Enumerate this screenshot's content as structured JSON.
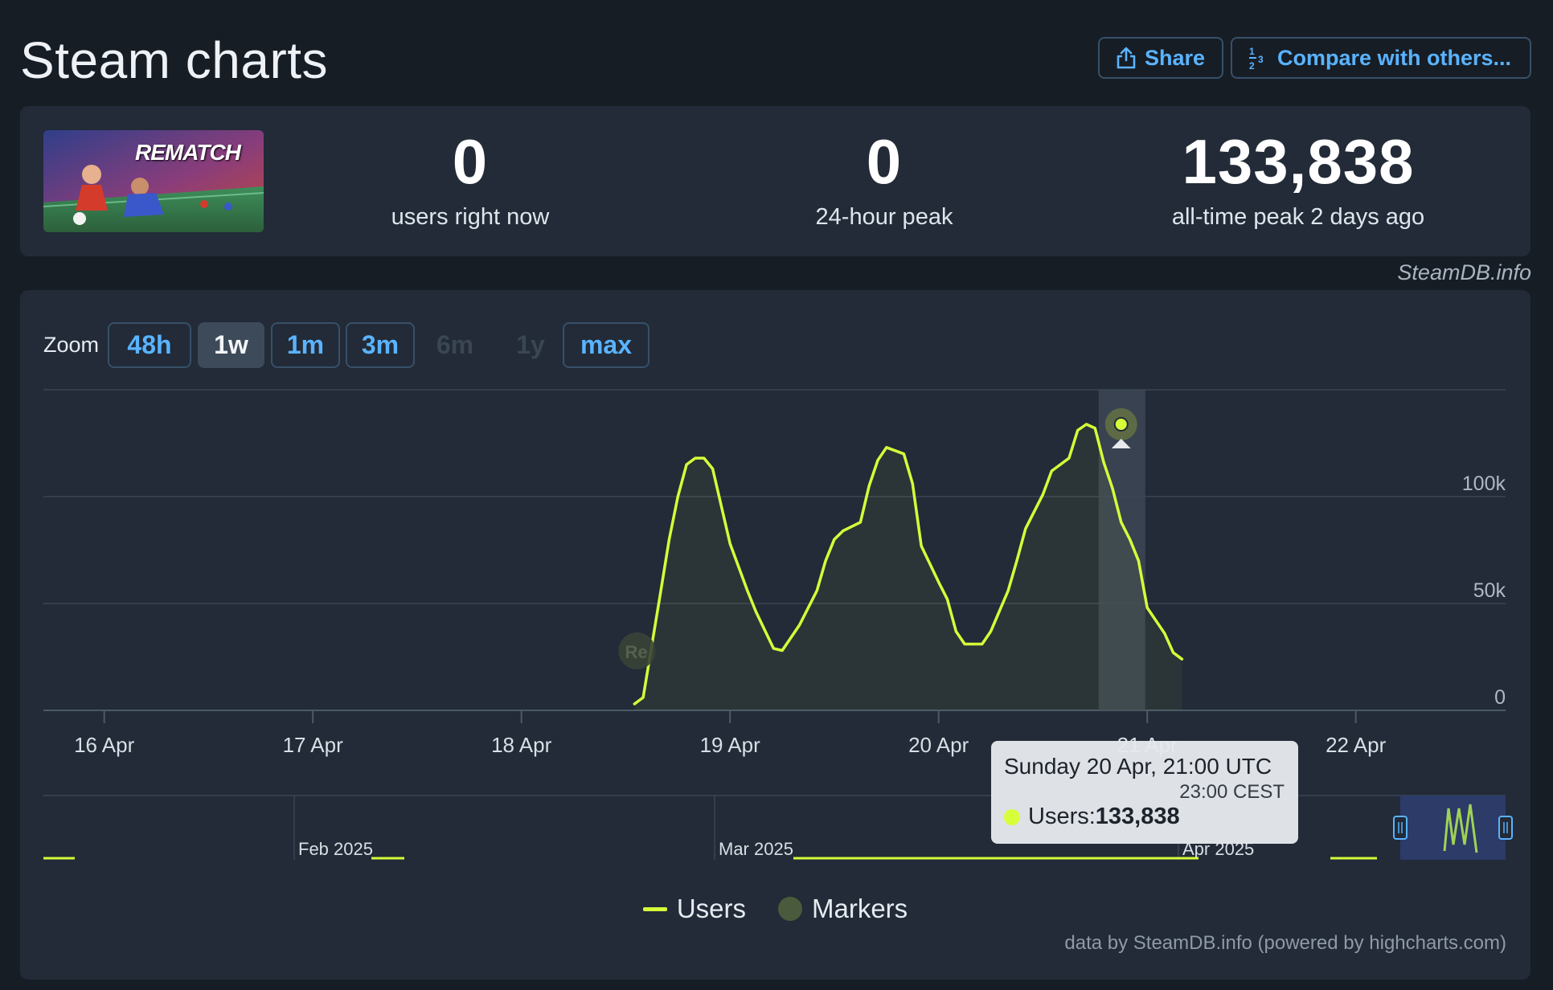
{
  "header": {
    "title": "Steam charts",
    "share_label": "Share",
    "compare_label": "Compare with others..."
  },
  "game": {
    "logo_text": "REMATCH"
  },
  "stats": [
    {
      "value": "0",
      "label": "users right now"
    },
    {
      "value": "0",
      "label": "24-hour peak"
    },
    {
      "value": "133,838",
      "label": "all-time peak 2 days ago"
    }
  ],
  "credit_top": "SteamDB.info",
  "zoom": {
    "label": "Zoom",
    "options": [
      {
        "label": "48h",
        "state": "enabled"
      },
      {
        "label": "1w",
        "state": "active"
      },
      {
        "label": "1m",
        "state": "enabled"
      },
      {
        "label": "3m",
        "state": "enabled"
      },
      {
        "label": "6m",
        "state": "disabled"
      },
      {
        "label": "1y",
        "state": "disabled"
      },
      {
        "label": "max",
        "state": "enabled"
      }
    ]
  },
  "tooltip": {
    "title": "Sunday 20 Apr, 21:00 UTC",
    "subtitle": "23:00 CEST",
    "series_label": "Users: ",
    "value": "133,838"
  },
  "marker_label": "Re",
  "legend": {
    "users": "Users",
    "markers": "Markers"
  },
  "footer_credit": "data by SteamDB.info (powered by highcharts.com)",
  "colors": {
    "line": "#d6ff3a",
    "accent": "#5ab3ff",
    "background": "#171d25",
    "card": "#222b37"
  },
  "chart_data": {
    "type": "line",
    "x_tick_labels": [
      "16 Apr",
      "17 Apr",
      "18 Apr",
      "19 Apr",
      "20 Apr",
      "21 Apr",
      "22 Apr"
    ],
    "y_tick_labels": [
      "0",
      "50k",
      "100k"
    ],
    "ylim": [
      0,
      150000
    ],
    "grid": true,
    "legend_position": "bottom",
    "series": [
      {
        "name": "Users",
        "x": [
          "2025-04-18T13:00",
          "2025-04-18T14:00",
          "2025-04-18T16:00",
          "2025-04-18T17:00",
          "2025-04-18T18:00",
          "2025-04-18T19:00",
          "2025-04-18T20:00",
          "2025-04-18T21:00",
          "2025-04-18T22:00",
          "2025-04-19T00:00",
          "2025-04-19T02:00",
          "2025-04-19T03:00",
          "2025-04-19T05:00",
          "2025-04-19T06:00",
          "2025-04-19T08:00",
          "2025-04-19T09:00",
          "2025-04-19T10:00",
          "2025-04-19T11:00",
          "2025-04-19T12:00",
          "2025-04-19T13:00",
          "2025-04-19T15:00",
          "2025-04-19T16:00",
          "2025-04-19T17:00",
          "2025-04-19T18:00",
          "2025-04-19T20:00",
          "2025-04-19T21:00",
          "2025-04-19T22:00",
          "2025-04-20T00:00",
          "2025-04-20T01:00",
          "2025-04-20T02:00",
          "2025-04-20T03:00",
          "2025-04-20T05:00",
          "2025-04-20T06:00",
          "2025-04-20T08:00",
          "2025-04-20T09:00",
          "2025-04-20T10:00",
          "2025-04-20T12:00",
          "2025-04-20T13:00",
          "2025-04-20T15:00",
          "2025-04-20T16:00",
          "2025-04-20T17:00",
          "2025-04-20T18:00",
          "2025-04-20T19:00",
          "2025-04-20T20:00",
          "2025-04-20T21:00",
          "2025-04-20T22:00",
          "2025-04-20T23:00",
          "2025-04-21T00:00",
          "2025-04-21T02:00",
          "2025-04-21T03:00",
          "2025-04-21T04:00"
        ],
        "values": [
          3000,
          6000,
          55000,
          80000,
          100000,
          115000,
          118000,
          118000,
          113000,
          78000,
          56000,
          46000,
          29000,
          28000,
          40000,
          48000,
          56000,
          70000,
          80000,
          84000,
          88000,
          105000,
          117000,
          123000,
          120000,
          106000,
          77000,
          60000,
          52000,
          37000,
          31000,
          31000,
          37000,
          56000,
          70000,
          85000,
          101000,
          112000,
          118000,
          131000,
          133838,
          132000,
          116000,
          104000,
          88000,
          80000,
          70000,
          48000,
          36000,
          27000,
          24000
        ]
      }
    ],
    "markers": [
      {
        "x": "2025-04-18T12:00",
        "label": "Re"
      }
    ],
    "highlighted_point": {
      "x": "2025-04-20T21:00",
      "value": 133838
    },
    "navigator": {
      "labels": [
        "Feb 2025",
        "Mar 2025",
        "Apr 2025"
      ]
    }
  }
}
